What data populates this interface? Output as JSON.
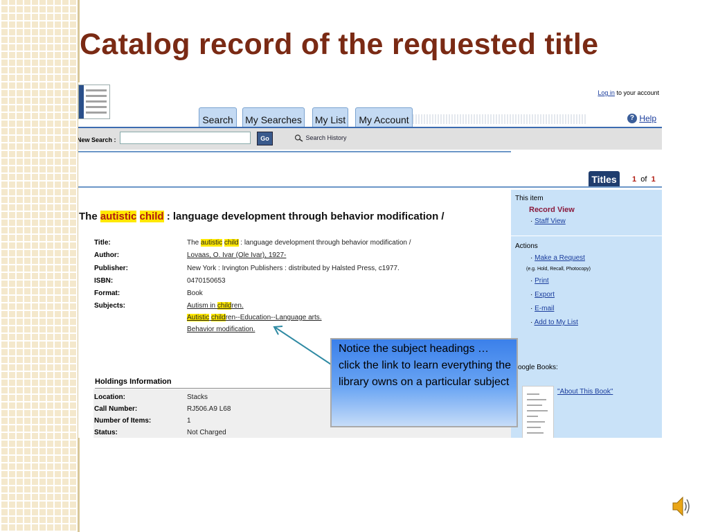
{
  "slide": {
    "title": "Catalog record of the requested title"
  },
  "header": {
    "login_link": "Log in",
    "login_suffix": "to your account",
    "tabs": [
      {
        "label": "Search"
      },
      {
        "label": "My Searches"
      },
      {
        "label": "My List"
      },
      {
        "label": "My Account"
      }
    ],
    "help": "Help"
  },
  "search_bar": {
    "label": "New Search :",
    "input_value": "",
    "go_label": "Go",
    "history_label": "Search History"
  },
  "results_nav": {
    "tab_label": "Titles",
    "current": "1",
    "of": "of",
    "total": "1"
  },
  "record": {
    "title_prefix": "The ",
    "title_hl1": "autistic",
    "title_hl2": "child",
    "title_rest": " : language development through behavior modification /",
    "fields": {
      "title_label": "Title:",
      "title_prefix": "The ",
      "title_hl1": "autistic",
      "title_hl2": "child",
      "title_rest": " : language development through behavior modification /",
      "author_label": "Author:",
      "author_value": "Lovaas, O. Ivar (Ole Ivar), 1927-",
      "publisher_label": "Publisher:",
      "publisher_value": "New York : Irvington Publishers : distributed by Halsted Press, c1977.",
      "isbn_label": "ISBN:",
      "isbn_value": "0470150653",
      "format_label": "Format:",
      "format_value": "Book",
      "subjects_label": "Subjects:"
    },
    "subjects": [
      {
        "pre": "Autism in ",
        "hl": "child",
        "post": "ren."
      },
      {
        "hl1": "Autistic",
        "hl2": "child",
        "post": "ren--Education--Language arts."
      },
      {
        "text": "Behavior modification."
      }
    ]
  },
  "holdings": {
    "heading": "Holdings Information",
    "location_label": "Location:",
    "location_value": "Stacks",
    "callnum_label": "Call Number:",
    "callnum_value": "RJ506.A9 L68",
    "items_label": "Number of Items:",
    "items_value": "1",
    "status_label": "Status:",
    "status_value": "Not Charged"
  },
  "right_panel": {
    "this_item": "This item",
    "record_view": "Record View",
    "staff_view": "Staff View",
    "actions": "Actions",
    "make_request": "Make a Request",
    "request_note": "(e.g. Hold, Recall, Photocopy)",
    "print": "Print",
    "export": "Export",
    "email": "E-mail",
    "add_list": "Add to My List",
    "google_books": "oogle Books:",
    "about_book": "\"About This Book\""
  },
  "callout": {
    "text": "Notice the subject headings … click the link to learn everything the library owns on a particular subject"
  },
  "colors": {
    "title": "#7a2a14",
    "highlight": "#ffe800",
    "link": "#1a3c9c",
    "panel": "#c9e2f8",
    "tab": "#c4daf3"
  }
}
